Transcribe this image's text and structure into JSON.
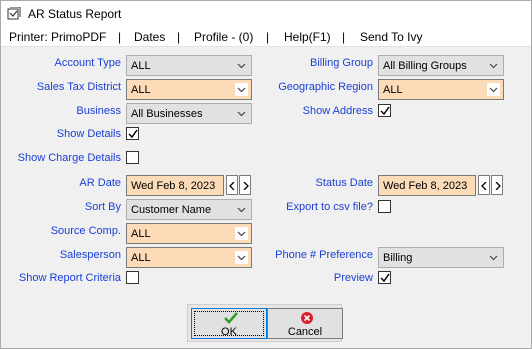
{
  "window": {
    "title": "AR Status Report"
  },
  "menu": {
    "printer": "Printer: PrimoPDF",
    "dates": "Dates",
    "profile": "Profile - (0)",
    "help": "Help(F1)",
    "send_to": "Send To Ivy",
    "separator": "|"
  },
  "form": {
    "account_type": {
      "label": "Account Type",
      "value": "ALL"
    },
    "sales_tax_district": {
      "label": "Sales Tax District",
      "value": "ALL"
    },
    "business": {
      "label": "Business",
      "value": "All Businesses"
    },
    "show_details": {
      "label": "Show Details",
      "checked": true
    },
    "show_charge_details": {
      "label": "Show Charge Details",
      "checked": false
    },
    "ar_date": {
      "label": "AR Date",
      "value": "Wed Feb 8, 2023"
    },
    "sort_by": {
      "label": "Sort By",
      "value": "Customer Name"
    },
    "source_comp": {
      "label": "Source Comp.",
      "value": "ALL"
    },
    "salesperson": {
      "label": "Salesperson",
      "value": "ALL"
    },
    "show_report_criteria": {
      "label": "Show Report Criteria",
      "checked": false
    },
    "billing_group": {
      "label": "Billing Group",
      "value": "All Billing Groups"
    },
    "geographic_region": {
      "label": "Geographic Region",
      "value": "ALL"
    },
    "show_address": {
      "label": "Show Address",
      "checked": true
    },
    "status_date": {
      "label": "Status Date",
      "value": "Wed Feb 8, 2023"
    },
    "export_csv": {
      "label": "Export to csv file?",
      "checked": false
    },
    "phone_preference": {
      "label": "Phone # Preference",
      "value": "Billing"
    },
    "preview": {
      "label": "Preview",
      "checked": true
    }
  },
  "buttons": {
    "ok": "OK",
    "cancel": "Cancel"
  },
  "colors": {
    "label_blue": "#1a3fd6",
    "highlight_field": "#fcdcb8",
    "ok_green": "#2e9b2e",
    "cancel_red": "#d8202a"
  }
}
